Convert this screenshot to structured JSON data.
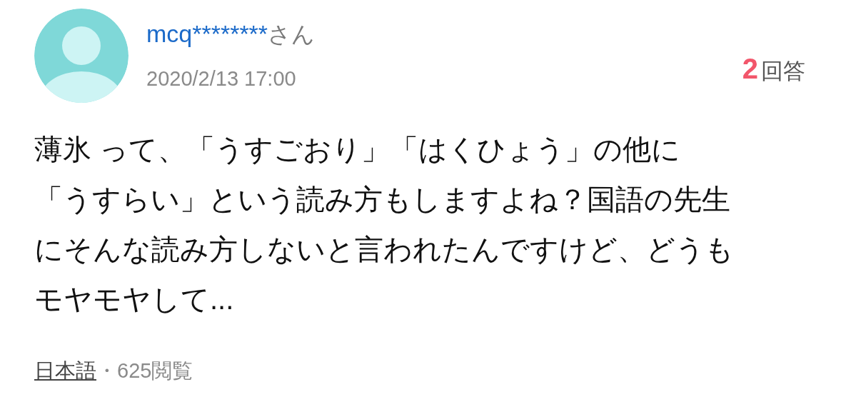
{
  "user": {
    "name": "mcq********",
    "suffix": "さん",
    "date": "2020/2/13 17:00"
  },
  "answers": {
    "count": "2",
    "label": "回答"
  },
  "question": {
    "lines": [
      "薄氷 って、「うすごおり」「はくひょう」の他に",
      "「うすらい」という読み方もしますよね？国語の先生",
      "にそんな読み方しないと言われたんですけど、どうも",
      "モヤモヤして..."
    ]
  },
  "footer": {
    "category": "日本語",
    "views": "・625閲覧"
  }
}
